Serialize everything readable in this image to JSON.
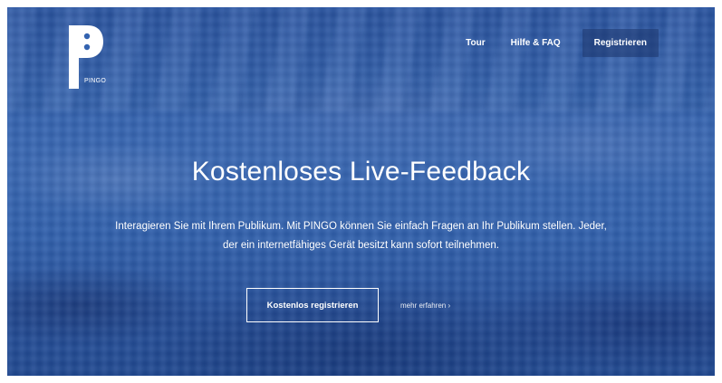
{
  "brand": {
    "logo_word": "PINGO"
  },
  "nav": {
    "items": [
      {
        "label": "Tour"
      },
      {
        "label": "Hilfe & FAQ"
      }
    ],
    "register_label": "Registrieren"
  },
  "hero": {
    "headline": "Kostenloses Live-Feedback",
    "lead_line1": "Interagieren Sie mit Ihrem Publikum. Mit PINGO können Sie einfach Fragen an Ihr Publikum stellen. Jeder,",
    "lead_line2": "der ein internetfähiges Gerät besitzt kann sofort teilnehmen.",
    "primary_button": "Kostenlos registrieren",
    "more_link": "mehr erfahren ›"
  },
  "colors": {
    "overlay_blue": "#3463b0",
    "text": "#ffffff"
  }
}
